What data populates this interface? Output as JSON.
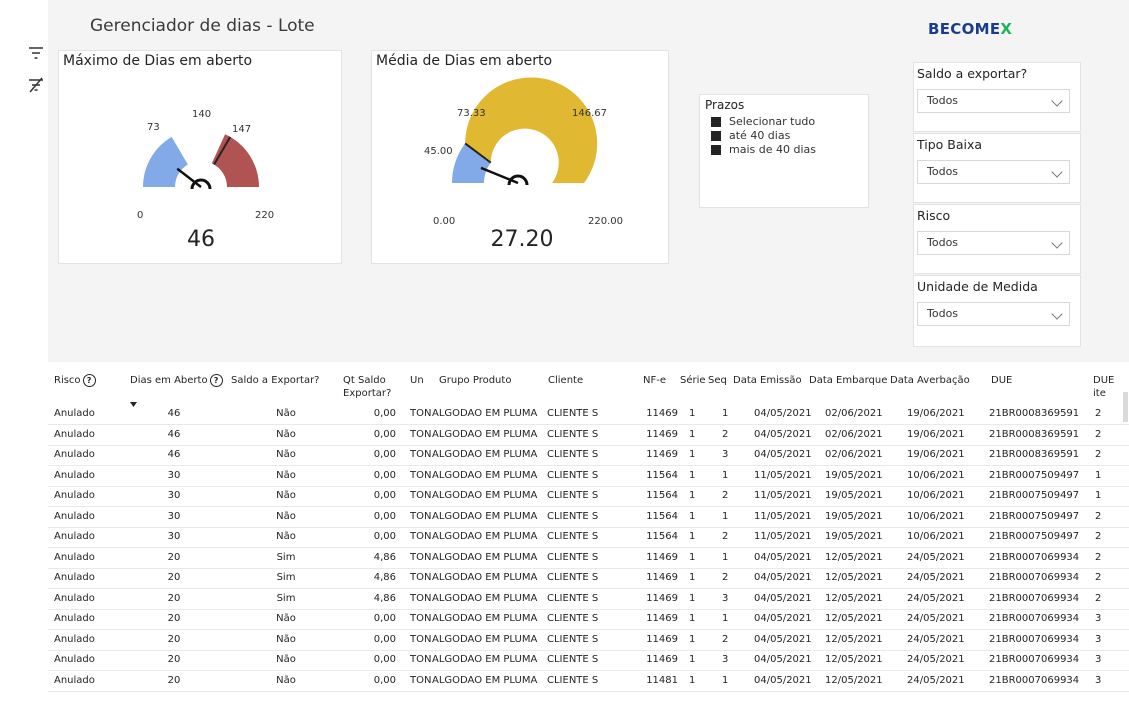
{
  "header": {
    "title": "Gerenciador de dias - Lote",
    "brand_main": "BECOME",
    "brand_x": "X"
  },
  "colors": {
    "blue": "#82a9e8",
    "red": "#b05353",
    "gold": "#e0b832",
    "ink": "#252423"
  },
  "sidebar": {
    "icons": [
      "filter-icon",
      "clear-filter-icon"
    ]
  },
  "gauge_max": {
    "title": "Máximo de Dias em aberto",
    "min_label": "0",
    "max_label": "220",
    "low_label": "73",
    "target_label": "140",
    "high_label": "147",
    "value_label": "46",
    "value": 46,
    "min": 0,
    "max": 220,
    "low": 73,
    "target": 140,
    "high": 147
  },
  "gauge_avg": {
    "title": "Média de Dias em aberto",
    "min_label": "0.00",
    "max_label": "220.00",
    "low_label": "45.00",
    "mid_label": "73.33",
    "high_label": "146.67",
    "value_label": "27.20",
    "value": 27.2,
    "min": 0,
    "max": 220,
    "low": 45,
    "mid": 73.33,
    "high": 146.67
  },
  "legend": {
    "title": "Prazos",
    "items": [
      "Selecionar tudo",
      "até 40 dias",
      "mais de 40 dias"
    ]
  },
  "slicers": [
    {
      "title": "Saldo a exportar?",
      "value": "Todos"
    },
    {
      "title": "Tipo Baixa",
      "value": "Todos"
    },
    {
      "title": "Risco",
      "value": "Todos"
    },
    {
      "title": "Unidade de Medida",
      "value": "Todos"
    }
  ],
  "table": {
    "headers": {
      "risco": "Risco",
      "dias": "Dias em Aberto",
      "saldo": "Saldo a Exportar?",
      "qt1": "Qt Saldo",
      "qt2": "Exportar?",
      "un": "Un",
      "grupo": "Grupo Produto",
      "cliente": "Cliente",
      "nfe": "NF-e",
      "serie": "Série",
      "seq": "Seq",
      "emissao": "Data Emissão",
      "embarque": "Data Embarque",
      "averbacao": "Data Averbação",
      "due": "DUE",
      "dueitem": "DUE ite"
    },
    "help_glyph": "?",
    "rows": [
      [
        "Anulado",
        "46",
        "Não",
        "0,00",
        "TON",
        "ALGODAO EM PLUMA",
        "CLIENTE S",
        "11469",
        "1",
        "1",
        "04/05/2021",
        "02/06/2021",
        "19/06/2021",
        "21BR0008369591",
        "2"
      ],
      [
        "Anulado",
        "46",
        "Não",
        "0,00",
        "TON",
        "ALGODAO EM PLUMA",
        "CLIENTE S",
        "11469",
        "1",
        "2",
        "04/05/2021",
        "02/06/2021",
        "19/06/2021",
        "21BR0008369591",
        "2"
      ],
      [
        "Anulado",
        "46",
        "Não",
        "0,00",
        "TON",
        "ALGODAO EM PLUMA",
        "CLIENTE S",
        "11469",
        "1",
        "3",
        "04/05/2021",
        "02/06/2021",
        "19/06/2021",
        "21BR0008369591",
        "2"
      ],
      [
        "Anulado",
        "30",
        "Não",
        "0,00",
        "TON",
        "ALGODAO EM PLUMA",
        "CLIENTE S",
        "11564",
        "1",
        "1",
        "11/05/2021",
        "19/05/2021",
        "10/06/2021",
        "21BR0007509497",
        "1"
      ],
      [
        "Anulado",
        "30",
        "Não",
        "0,00",
        "TON",
        "ALGODAO EM PLUMA",
        "CLIENTE S",
        "11564",
        "1",
        "2",
        "11/05/2021",
        "19/05/2021",
        "10/06/2021",
        "21BR0007509497",
        "1"
      ],
      [
        "Anulado",
        "30",
        "Não",
        "0,00",
        "TON",
        "ALGODAO EM PLUMA",
        "CLIENTE S",
        "11564",
        "1",
        "1",
        "11/05/2021",
        "19/05/2021",
        "10/06/2021",
        "21BR0007509497",
        "2"
      ],
      [
        "Anulado",
        "30",
        "Não",
        "0,00",
        "TON",
        "ALGODAO EM PLUMA",
        "CLIENTE S",
        "11564",
        "1",
        "2",
        "11/05/2021",
        "19/05/2021",
        "10/06/2021",
        "21BR0007509497",
        "2"
      ],
      [
        "Anulado",
        "20",
        "Sim",
        "4,86",
        "TON",
        "ALGODAO EM PLUMA",
        "CLIENTE S",
        "11469",
        "1",
        "1",
        "04/05/2021",
        "12/05/2021",
        "24/05/2021",
        "21BR0007069934",
        "2"
      ],
      [
        "Anulado",
        "20",
        "Sim",
        "4,86",
        "TON",
        "ALGODAO EM PLUMA",
        "CLIENTE S",
        "11469",
        "1",
        "2",
        "04/05/2021",
        "12/05/2021",
        "24/05/2021",
        "21BR0007069934",
        "2"
      ],
      [
        "Anulado",
        "20",
        "Sim",
        "4,86",
        "TON",
        "ALGODAO EM PLUMA",
        "CLIENTE S",
        "11469",
        "1",
        "3",
        "04/05/2021",
        "12/05/2021",
        "24/05/2021",
        "21BR0007069934",
        "2"
      ],
      [
        "Anulado",
        "20",
        "Não",
        "0,00",
        "TON",
        "ALGODAO EM PLUMA",
        "CLIENTE S",
        "11469",
        "1",
        "1",
        "04/05/2021",
        "12/05/2021",
        "24/05/2021",
        "21BR0007069934",
        "3"
      ],
      [
        "Anulado",
        "20",
        "Não",
        "0,00",
        "TON",
        "ALGODAO EM PLUMA",
        "CLIENTE S",
        "11469",
        "1",
        "2",
        "04/05/2021",
        "12/05/2021",
        "24/05/2021",
        "21BR0007069934",
        "3"
      ],
      [
        "Anulado",
        "20",
        "Não",
        "0,00",
        "TON",
        "ALGODAO EM PLUMA",
        "CLIENTE S",
        "11469",
        "1",
        "3",
        "04/05/2021",
        "12/05/2021",
        "24/05/2021",
        "21BR0007069934",
        "3"
      ],
      [
        "Anulado",
        "20",
        "Não",
        "0,00",
        "TON",
        "ALGODAO EM PLUMA",
        "CLIENTE S",
        "11481",
        "1",
        "1",
        "04/05/2021",
        "12/05/2021",
        "24/05/2021",
        "21BR0007069934",
        "3"
      ]
    ]
  }
}
